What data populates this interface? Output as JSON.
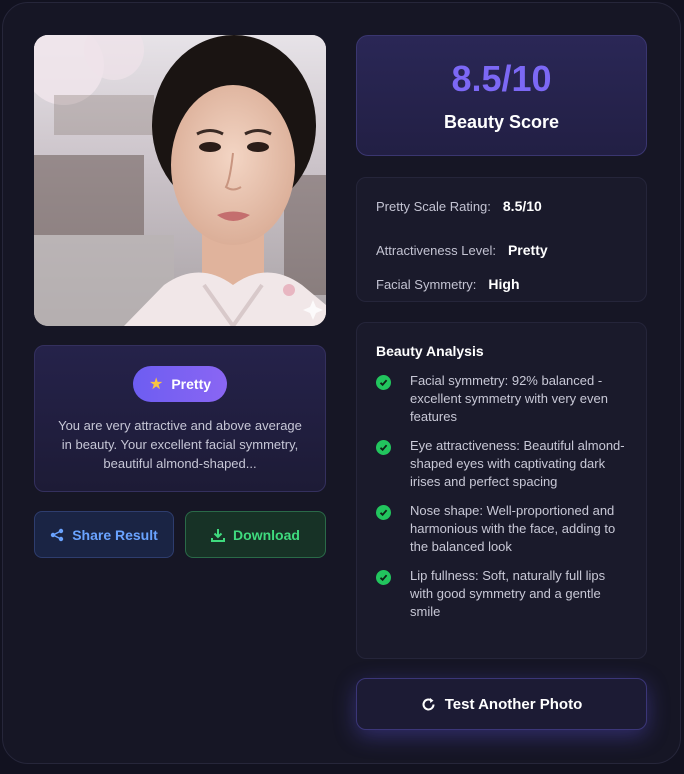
{
  "verdict": {
    "badge_label": "Pretty",
    "badge_icon": "star-icon",
    "description": "You are very attractive and above average in beauty. Your excellent facial symmetry, beautiful almond-shaped..."
  },
  "actions": {
    "share_label": "Share Result",
    "download_label": "Download",
    "test_another_label": "Test Another Photo"
  },
  "score": {
    "value": "8.5/10",
    "label": "Beauty Score"
  },
  "details": [
    {
      "key": "Pretty Scale Rating:",
      "value": "8.5/10"
    },
    {
      "key": "Attractiveness Level:",
      "value": "Pretty"
    },
    {
      "key": "Facial Symmetry:",
      "value": "High"
    }
  ],
  "analysis": {
    "title": "Beauty Analysis",
    "items": [
      "Facial symmetry: 92% balanced - excellent symmetry with very even features",
      "Eye attractiveness: Beautiful almond-shaped eyes with captivating dark irises and perfect spacing",
      "Nose shape: Well-proportioned and harmonious with the face, adding to the balanced look",
      "Lip fullness: Soft, naturally full lips with good symmetry and a gentle smile"
    ]
  },
  "colors": {
    "accent": "#7c68f5",
    "success": "#22c55e",
    "share": "#6aa3ff",
    "download": "#3fdb7e"
  }
}
